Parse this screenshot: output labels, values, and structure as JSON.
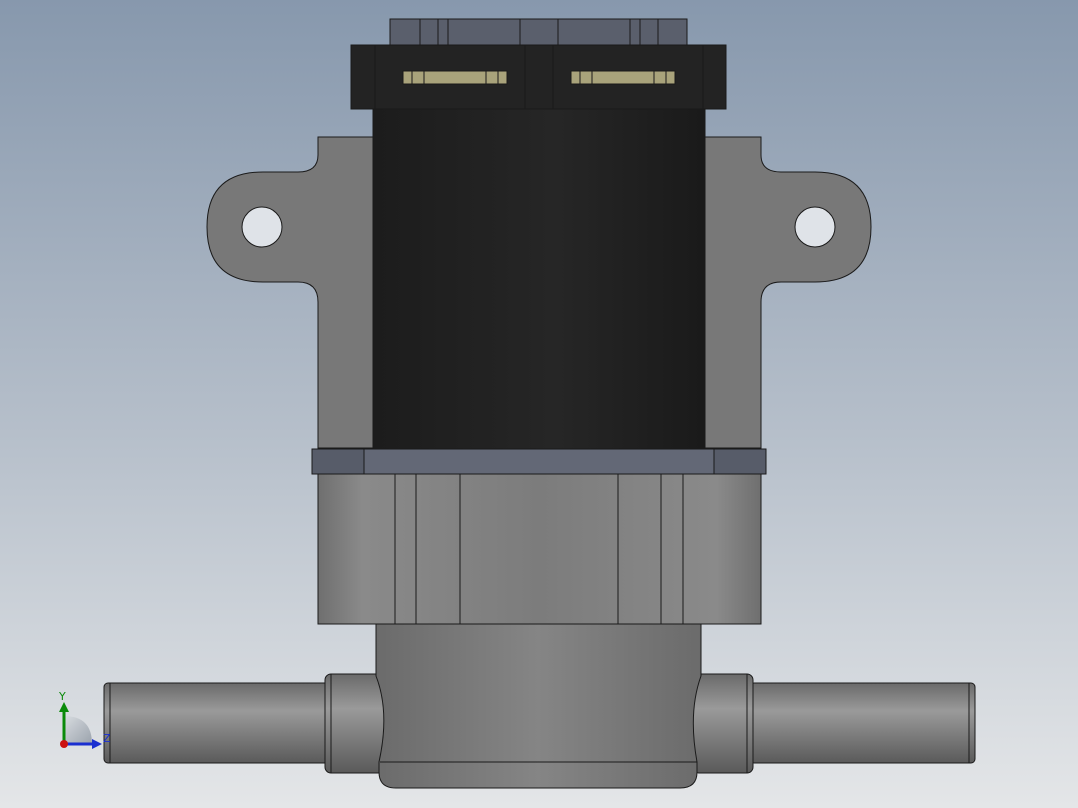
{
  "triad": {
    "y_label": "Y",
    "z_label": "Z"
  },
  "colors": {
    "bg_top": "#8a9bb0",
    "bg_bottom": "#e6e8ea",
    "body_gray": "#7a7a7a",
    "coil_black": "#1e1e1e",
    "collar_slate": "#5d6270",
    "terminal_tan": "#a8a27a",
    "y_axis": "#0a8a0a",
    "z_axis": "#1a2fd0",
    "origin": "#cc1111"
  }
}
